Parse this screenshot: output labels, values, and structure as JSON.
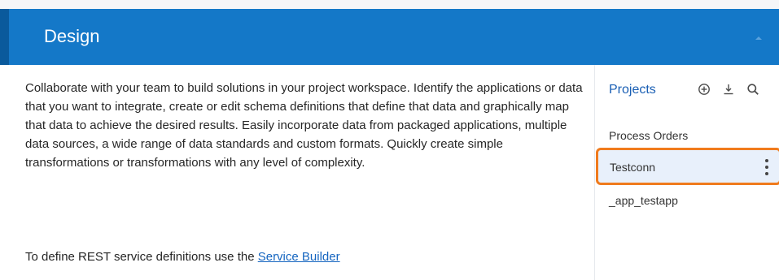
{
  "panel": {
    "title": "Design",
    "collapse_icon": "chevron-up-icon",
    "colors": {
      "header": "#1478c8",
      "header_accent": "#0a5a9c",
      "link": "#1565c0",
      "selection_outline": "#f07b1d",
      "selection_fill": "#e8f0fb",
      "side_title": "#1a5fb4"
    }
  },
  "main": {
    "description": "Collaborate with your team to build solutions in your project workspace. Identify the applications or data that you want to integrate, create or edit schema definitions that define that data and graphically map that data to achieve the desired results. Easily incorporate data from packaged applications, multiple data sources, a wide range of data standards and custom formats. Quickly create simple transformations or transformations with any level of complexity.",
    "rest_prefix": "To define REST service definitions use the ",
    "rest_link": "Service Builder"
  },
  "projects": {
    "title": "Projects",
    "tools": [
      "add-circle-icon",
      "download-icon",
      "search-icon"
    ],
    "items": [
      {
        "label": "Process Orders",
        "selected": false
      },
      {
        "label": "Testconn",
        "selected": true
      },
      {
        "label": "_app_testapp",
        "selected": false
      }
    ],
    "item_menu_icon": "more-vertical-icon"
  }
}
